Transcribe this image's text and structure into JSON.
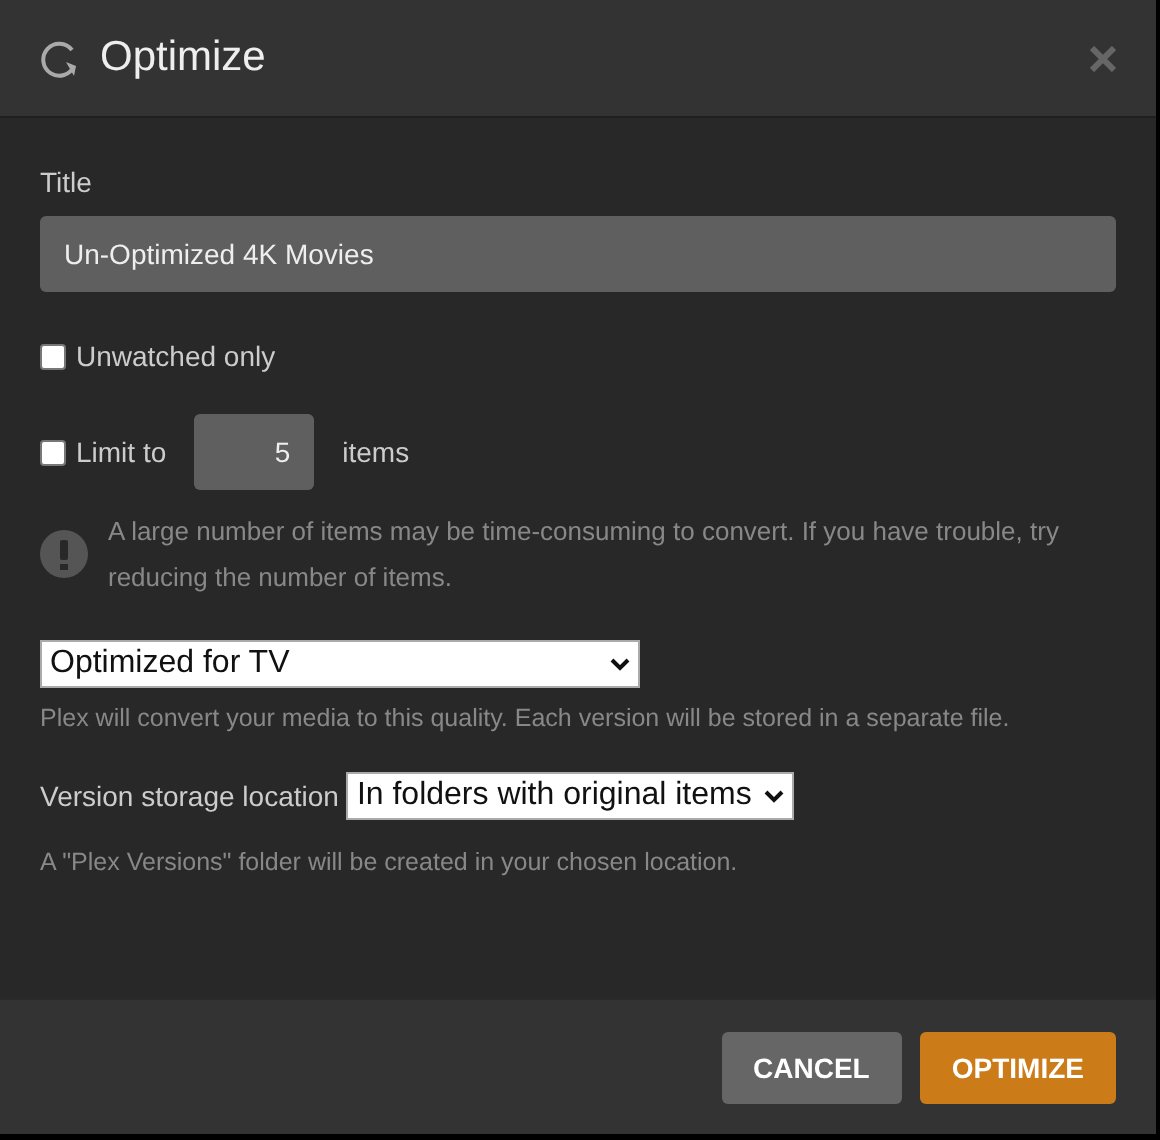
{
  "dialog": {
    "title": "Optimize"
  },
  "title_field": {
    "label": "Title",
    "value": "Un-Optimized 4K Movies"
  },
  "unwatched_only": {
    "label": "Unwatched only",
    "checked": false
  },
  "limit": {
    "label": "Limit to",
    "checked": false,
    "value": "5",
    "unit": "items"
  },
  "warning": "A large number of items may be time-consuming to convert. If you have trouble, try reducing the number of items.",
  "quality": {
    "value": "Optimized for TV",
    "hint": "Plex will convert your media to this quality. Each version will be stored in a separate file."
  },
  "storage": {
    "label": "Version storage location",
    "value": "In folders with original items",
    "hint": "A \"Plex Versions\" folder will be created in your chosen location."
  },
  "buttons": [
    {
      "label": "CANCEL",
      "kind": "secondary"
    },
    {
      "label": "OPTIMIZE",
      "kind": "primary"
    }
  ]
}
